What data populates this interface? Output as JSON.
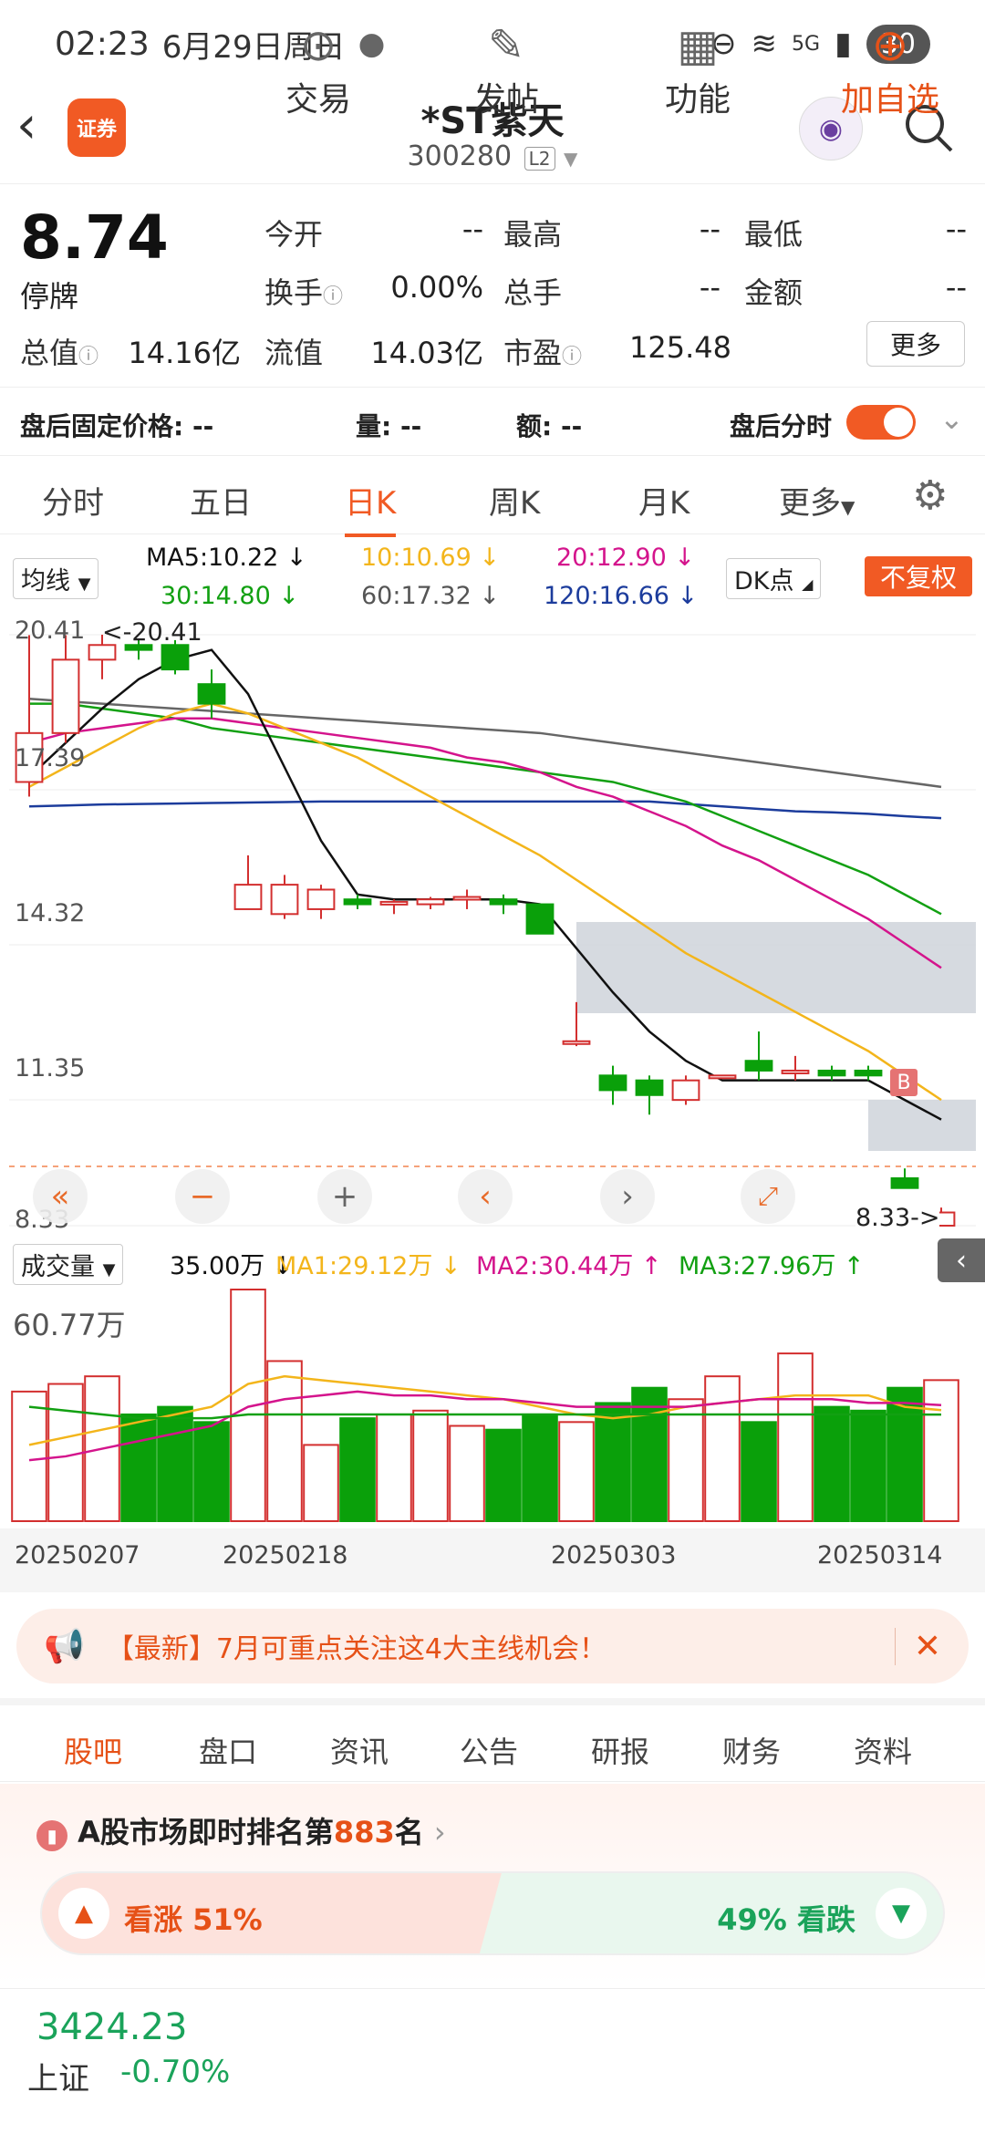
{
  "status": {
    "time": "02:23",
    "date": "6月29日周日",
    "battery": "30",
    "network": "5G"
  },
  "header": {
    "logo_text": "证券",
    "title": "*ST紫天",
    "code": "300280",
    "level": "L2"
  },
  "quote": {
    "price": "8.74",
    "state": "停牌",
    "fields": [
      {
        "label": "今开",
        "value": "--"
      },
      {
        "label": "最高",
        "value": "--"
      },
      {
        "label": "最低",
        "value": "--"
      },
      {
        "label": "换手",
        "value": "0.00%"
      },
      {
        "label": "总手",
        "value": "--"
      },
      {
        "label": "金额",
        "value": "--"
      },
      {
        "label": "总值",
        "value": "14.16亿"
      },
      {
        "label": "流值",
        "value": "14.03亿"
      },
      {
        "label": "市盈",
        "value": "125.48"
      }
    ],
    "more_label": "更多"
  },
  "after_hours": {
    "price_label": "盘后固定价格:",
    "price": "--",
    "vol_label": "量:",
    "vol": "--",
    "amt_label": "额:",
    "amt": "--",
    "toggle_label": "盘后分时"
  },
  "tabs": [
    "分时",
    "五日",
    "日K",
    "周K",
    "月K",
    "更多"
  ],
  "active_tab": "日K",
  "ma_legend": {
    "type_chip": "均线",
    "ma5": "MA5:10.22",
    "ma10": "10:10.69",
    "ma20": "20:12.90",
    "ma30": "30:14.80",
    "ma60": "60:17.32",
    "ma120": "120:16.66",
    "dk_chip": "DK点",
    "fq_label": "不复权"
  },
  "price_axis": [
    "20.41",
    "17.39",
    "14.32",
    "11.35",
    "8.33"
  ],
  "markers": {
    "high": "<-20.41",
    "low": "8.33->",
    "signal": "B"
  },
  "colors": {
    "accent": "#f15a24",
    "up": "#d32f2f",
    "down": "#0aa00a",
    "ma5": "#111111",
    "ma10": "#f3b51b",
    "ma20": "#d4148c",
    "ma30": "#12a012",
    "ma60": "#666666",
    "ma120": "#1c3c9c"
  },
  "volume_legend": {
    "chip": "成交量",
    "vol": "35.00万",
    "ma1": "MA1:29.12万",
    "ma2": "MA2:30.44万",
    "ma3": "MA3:27.96万",
    "max": "60.77万"
  },
  "dates": [
    "20250207",
    "20250218",
    "20250303",
    "20250314"
  ],
  "chart_data": {
    "type": "candlestick",
    "ylim": [
      8.33,
      20.41
    ],
    "candles": [
      {
        "o": 17.4,
        "c": 18.4,
        "h": 20.4,
        "l": 17.1
      },
      {
        "o": 18.4,
        "c": 19.9,
        "h": 20.4,
        "l": 18.2
      },
      {
        "o": 19.9,
        "c": 20.2,
        "h": 20.41,
        "l": 19.5
      },
      {
        "o": 20.2,
        "c": 20.1,
        "h": 20.3,
        "l": 19.9
      },
      {
        "o": 20.2,
        "c": 19.7,
        "h": 20.3,
        "l": 19.6
      },
      {
        "o": 19.4,
        "c": 19.0,
        "h": 19.7,
        "l": 18.7
      },
      {
        "o": 14.8,
        "c": 15.3,
        "h": 15.9,
        "l": 14.8
      },
      {
        "o": 14.7,
        "c": 15.3,
        "h": 15.5,
        "l": 14.6
      },
      {
        "o": 14.8,
        "c": 15.2,
        "h": 15.3,
        "l": 14.6
      },
      {
        "o": 15.0,
        "c": 14.9,
        "h": 15.1,
        "l": 14.8
      },
      {
        "o": 14.9,
        "c": 14.95,
        "h": 15.0,
        "l": 14.7
      },
      {
        "o": 14.9,
        "c": 15.0,
        "h": 15.05,
        "l": 14.8
      },
      {
        "o": 15.0,
        "c": 15.05,
        "h": 15.2,
        "l": 14.8
      },
      {
        "o": 15.0,
        "c": 14.9,
        "h": 15.1,
        "l": 14.7
      },
      {
        "o": 14.9,
        "c": 14.3,
        "h": 14.9,
        "l": 14.3
      },
      {
        "o": 12.1,
        "c": 12.1,
        "h": 12.9,
        "l": 12.0
      },
      {
        "o": 11.4,
        "c": 11.1,
        "h": 11.6,
        "l": 10.8
      },
      {
        "o": 11.3,
        "c": 11.0,
        "h": 11.4,
        "l": 10.6
      },
      {
        "o": 10.9,
        "c": 11.3,
        "h": 11.4,
        "l": 10.8
      },
      {
        "o": 11.4,
        "c": 11.4,
        "h": 11.4,
        "l": 11.4
      },
      {
        "o": 11.7,
        "c": 11.5,
        "h": 12.3,
        "l": 11.3
      },
      {
        "o": 11.5,
        "c": 11.5,
        "h": 11.8,
        "l": 11.3
      },
      {
        "o": 11.5,
        "c": 11.4,
        "h": 11.6,
        "l": 11.3
      },
      {
        "o": 11.5,
        "c": 11.4,
        "h": 11.6,
        "l": 11.3
      },
      {
        "o": 9.3,
        "c": 9.1,
        "h": 9.5,
        "l": 9.1
      },
      {
        "o": 8.33,
        "c": 8.6,
        "h": 8.7,
        "l": 8.33
      }
    ],
    "ma": {
      "ma5": [
        17.5,
        18.2,
        18.9,
        19.5,
        19.9,
        20.1,
        19.2,
        17.7,
        16.2,
        15.1,
        15.0,
        15.0,
        15.0,
        15.0,
        14.9,
        14.0,
        13.1,
        12.3,
        11.7,
        11.3,
        11.3,
        11.3,
        11.3,
        11.3,
        10.9,
        10.5
      ],
      "ma10": [
        17.3,
        17.7,
        18.1,
        18.5,
        18.8,
        19.0,
        18.8,
        18.5,
        18.2,
        17.9,
        17.5,
        17.1,
        16.7,
        16.3,
        15.9,
        15.4,
        14.9,
        14.4,
        13.9,
        13.5,
        13.1,
        12.7,
        12.3,
        11.9,
        11.4,
        10.9
      ],
      "ma20": [
        18.2,
        18.4,
        18.5,
        18.6,
        18.7,
        18.7,
        18.6,
        18.5,
        18.4,
        18.3,
        18.2,
        18.1,
        17.9,
        17.8,
        17.6,
        17.3,
        17.1,
        16.8,
        16.5,
        16.1,
        15.8,
        15.4,
        15.0,
        14.6,
        14.1,
        13.6
      ],
      "ma30": [
        19.0,
        19.0,
        18.9,
        18.8,
        18.7,
        18.5,
        18.4,
        18.3,
        18.2,
        18.1,
        18.0,
        17.9,
        17.8,
        17.7,
        17.6,
        17.5,
        17.4,
        17.2,
        17.0,
        16.7,
        16.4,
        16.1,
        15.8,
        15.5,
        15.1,
        14.7
      ],
      "ma60": [
        19.1,
        19.05,
        19.0,
        18.95,
        18.9,
        18.85,
        18.8,
        18.75,
        18.7,
        18.65,
        18.6,
        18.55,
        18.5,
        18.45,
        18.4,
        18.3,
        18.2,
        18.1,
        18.0,
        17.9,
        17.8,
        17.7,
        17.6,
        17.5,
        17.4,
        17.3
      ],
      "ma120": [
        16.9,
        16.92,
        16.94,
        16.95,
        16.96,
        16.97,
        16.98,
        16.99,
        17.0,
        17.0,
        17.0,
        17.0,
        17.0,
        17.0,
        17.0,
        17.0,
        17.0,
        17.0,
        16.95,
        16.9,
        16.85,
        16.8,
        16.78,
        16.75,
        16.7,
        16.66
      ]
    },
    "volume": [
      34,
      36,
      38,
      28,
      30,
      26,
      60.77,
      42,
      20,
      27,
      28,
      29,
      25,
      24,
      28,
      26,
      31,
      35,
      32,
      38,
      26,
      44,
      30,
      29,
      35,
      37
    ],
    "volume_ma": {
      "ma1": [
        20,
        22,
        24,
        26,
        28,
        30,
        36,
        38,
        37,
        36,
        35,
        34,
        33,
        32,
        30,
        28,
        27,
        28,
        30,
        31,
        32,
        33,
        33,
        33,
        30,
        29.12
      ],
      "ma2": [
        16,
        17,
        19,
        21,
        23,
        25,
        30,
        32,
        33,
        34,
        33,
        33,
        32,
        32,
        31,
        30,
        30,
        30,
        30,
        31,
        32,
        32,
        32,
        31,
        31,
        30.44
      ],
      "ma3": [
        30,
        29,
        28,
        27,
        27,
        27,
        28,
        28,
        28,
        28,
        28,
        28,
        28,
        28,
        28,
        28,
        28,
        28,
        28,
        28,
        28,
        28,
        28,
        28,
        28,
        27.96
      ]
    }
  },
  "banner": {
    "text": "【最新】7月可重点关注这4大主线机会！"
  },
  "bottom_tabs": [
    "股吧",
    "盘口",
    "资讯",
    "公告",
    "研报",
    "财务",
    "资料"
  ],
  "rank": {
    "prefix": "A股市场即时排名第",
    "num": "883",
    "suffix": "名"
  },
  "vote": {
    "up_label": "看涨 51%",
    "down_label": "49% 看跌",
    "up_pct": 51
  },
  "index": {
    "value": "3424.23",
    "name": "上证",
    "change": "-0.70%"
  },
  "bottom_bar": [
    "交易",
    "发帖",
    "功能",
    "加自选"
  ]
}
